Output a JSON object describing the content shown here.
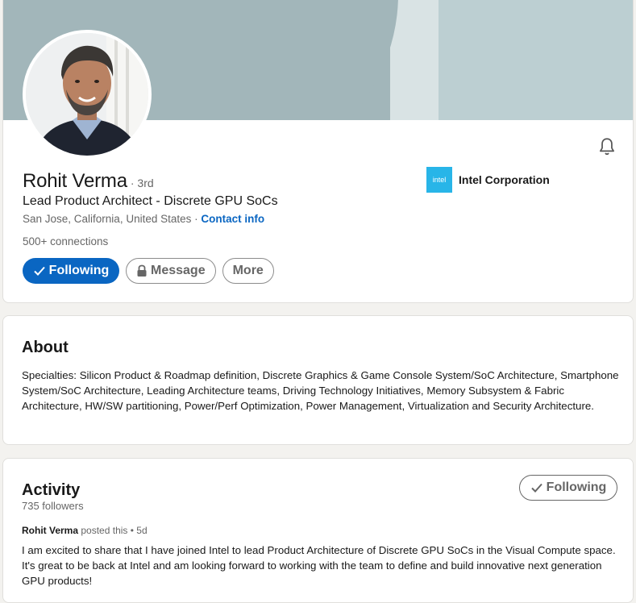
{
  "profile": {
    "name": "Rohit Verma",
    "degree": "· 3rd",
    "headline": "Lead Product Architect - Discrete GPU SoCs",
    "location": "San Jose, California, United States",
    "location_sep": " · ",
    "contact_info": "Contact info",
    "connections": "500+ connections",
    "company": {
      "logo_text": "intel",
      "name": "Intel Corporation"
    },
    "buttons": {
      "following": "Following",
      "message": "Message",
      "more": "More"
    },
    "notification_icon": "bell-icon",
    "colors": {
      "primary": "#0a66c2",
      "banner": "#a2b6ba",
      "company_logo": "#28b5e8"
    }
  },
  "about": {
    "title": "About",
    "text": "Specialties: Silicon Product & Roadmap definition, Discrete Graphics & Game Console System/SoC Architecture, Smartphone System/SoC Architecture, Leading Architecture teams, Driving Technology Initiatives, Memory Subsystem & Fabric Architecture, HW/SW partitioning, Power/Perf Optimization, Power Management, Virtualization and Security Architecture."
  },
  "activity": {
    "title": "Activity",
    "followers": "735 followers",
    "following_button": "Following",
    "post": {
      "author": "Rohit Verma",
      "meta": " posted this • 5d",
      "text": "I am excited to share that I have joined Intel to lead Product Architecture of Discrete GPU SoCs in the Visual Compute space. It's great to be back at Intel and am looking forward to working with the team to define and build innovative next generation GPU products!"
    }
  }
}
